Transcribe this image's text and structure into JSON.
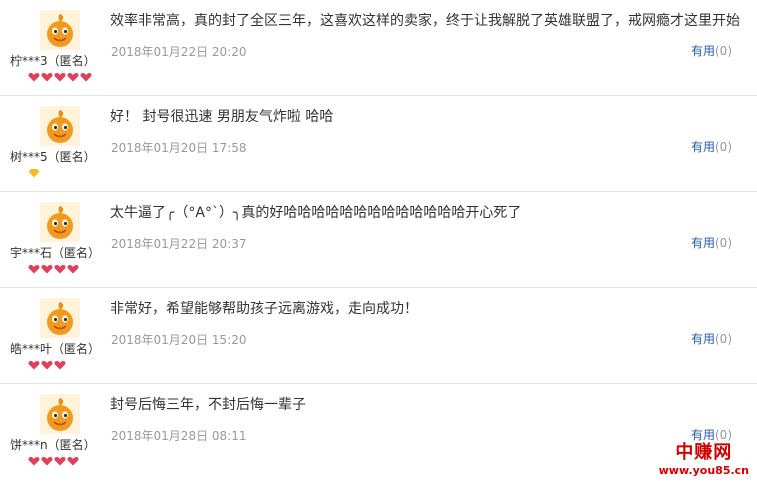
{
  "reviews": [
    {
      "user": "柠***3（匿名）",
      "content": "效率非常高，真的封了全区三年，这喜欢这样的卖家，终于让我解脱了英雄联盟了，戒网瘾才这里开始",
      "time": "2018年01月22日 20:20",
      "helpful_label": "有用",
      "helpful_count": "(0)",
      "badge": {
        "type": "heart",
        "count": 5
      }
    },
    {
      "user": "树***5（匿名）",
      "content": "好！ 封号很迅速 男朋友气炸啦 哈哈",
      "time": "2018年01月20日 17:58",
      "helpful_label": "有用",
      "helpful_count": "(0)",
      "badge": {
        "type": "diamond",
        "count": 1
      }
    },
    {
      "user": "宇***石（匿名）",
      "content": "太牛逼了╭（°A°`）╮真的好哈哈哈哈哈哈哈哈哈哈哈哈哈开心死了",
      "time": "2018年01月22日 20:37",
      "helpful_label": "有用",
      "helpful_count": "(0)",
      "badge": {
        "type": "heart",
        "count": 4
      }
    },
    {
      "user": "皓***叶（匿名）",
      "content": "非常好，希望能够帮助孩子远离游戏，走向成功！",
      "time": "2018年01月20日 15:20",
      "helpful_label": "有用",
      "helpful_count": "(0)",
      "badge": {
        "type": "heart",
        "count": 3
      }
    },
    {
      "user": "饼***n（匿名）",
      "content": "封号后悔三年，不封后悔一辈子",
      "time": "2018年01月28日 08:11",
      "helpful_label": "有用",
      "helpful_count": "(0)",
      "badge": {
        "type": "heart",
        "count": 4
      }
    }
  ],
  "watermark": {
    "top": "中赚网",
    "bottom": "www.you85.cn"
  },
  "colors": {
    "heart": "#e0405a",
    "diamond": "#f0c020",
    "link": "#2a5caa",
    "meta": "#999999"
  }
}
